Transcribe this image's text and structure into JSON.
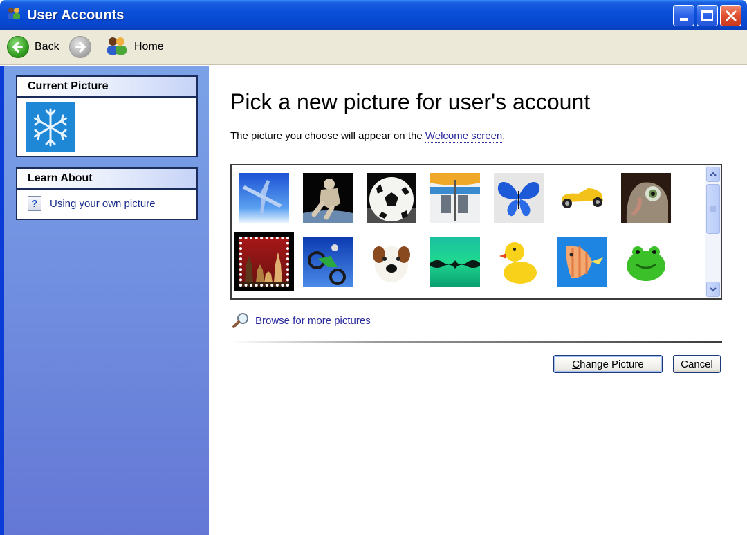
{
  "window": {
    "title": "User Accounts",
    "controls": {
      "minimize": "minimize",
      "maximize": "maximize",
      "close": "close"
    }
  },
  "toolbar": {
    "back_label": "Back",
    "forward_label": "",
    "home_label": "Home"
  },
  "sidebar": {
    "current_picture": {
      "header": "Current Picture",
      "picture": "snowflake"
    },
    "learn_about": {
      "header": "Learn About",
      "items": [
        {
          "label": "Using your own picture",
          "icon": "help-icon"
        }
      ]
    }
  },
  "main": {
    "heading": "Pick a new picture for user's account",
    "description_prefix": "The picture you choose will appear on the ",
    "description_link": "Welcome screen",
    "description_suffix": ".",
    "pictures": [
      {
        "name": "airplane",
        "selected": false
      },
      {
        "name": "astronaut",
        "selected": false
      },
      {
        "name": "soccer-ball",
        "selected": false
      },
      {
        "name": "beach-chairs",
        "selected": false
      },
      {
        "name": "butterfly",
        "selected": false
      },
      {
        "name": "race-car",
        "selected": false
      },
      {
        "name": "cat",
        "selected": false
      },
      {
        "name": "chess",
        "selected": true
      },
      {
        "name": "dirt-bike",
        "selected": false
      },
      {
        "name": "dog",
        "selected": false
      },
      {
        "name": "drip",
        "selected": false
      },
      {
        "name": "rubber-duck",
        "selected": false
      },
      {
        "name": "fish",
        "selected": false
      },
      {
        "name": "frog",
        "selected": false
      }
    ],
    "browse_label": "Browse for more pictures",
    "buttons": {
      "change_picture_prefix": "C",
      "change_picture_rest": "hange Picture",
      "cancel": "Cancel"
    }
  },
  "colors": {
    "titlebar": "#0a4fd8",
    "sidebar_top": "#7ba2e7",
    "sidebar_bottom": "#6477d5",
    "link": "#2b2ba0",
    "toolbar_bg": "#ece9d8"
  }
}
